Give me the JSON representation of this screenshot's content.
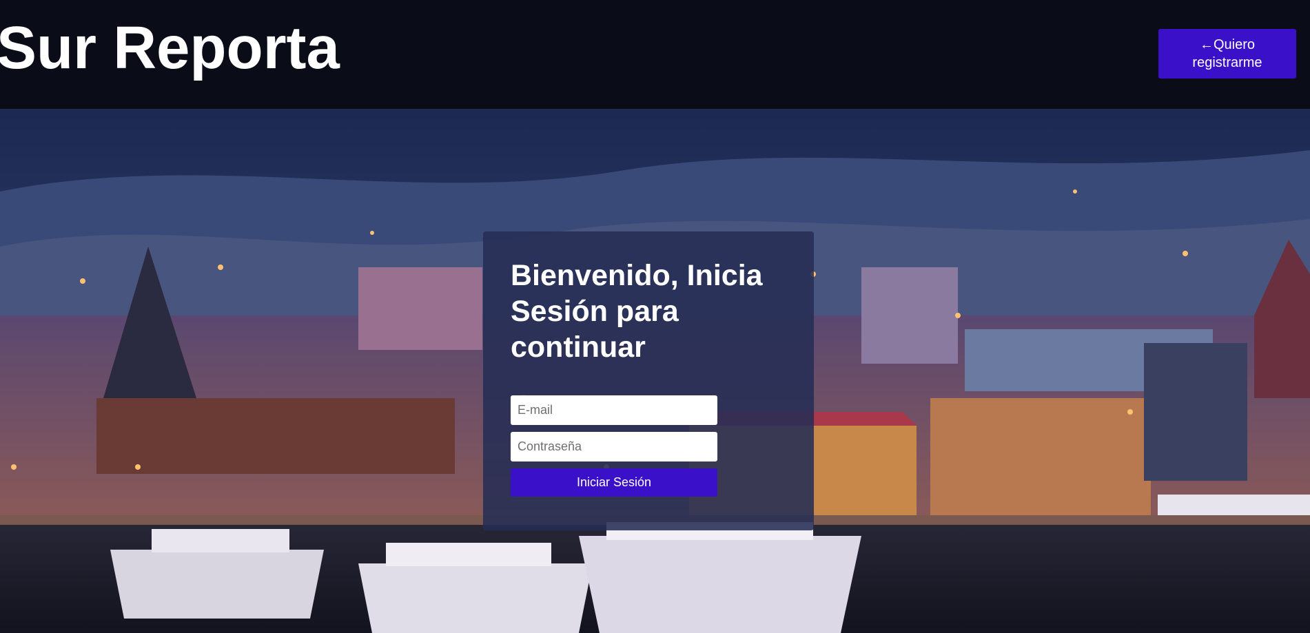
{
  "header": {
    "brand": "Sur Reporta",
    "register_button": "←Quiero registrarme"
  },
  "colors": {
    "header_bg": "#0a0d17",
    "accent": "#3a10c8",
    "card_bg": "#262e54"
  },
  "login": {
    "title": "Bienvenido, Inicia Sesión para continuar",
    "email_placeholder": "E-mail",
    "password_placeholder": "Contraseña",
    "submit_label": "Iniciar Sesión"
  }
}
